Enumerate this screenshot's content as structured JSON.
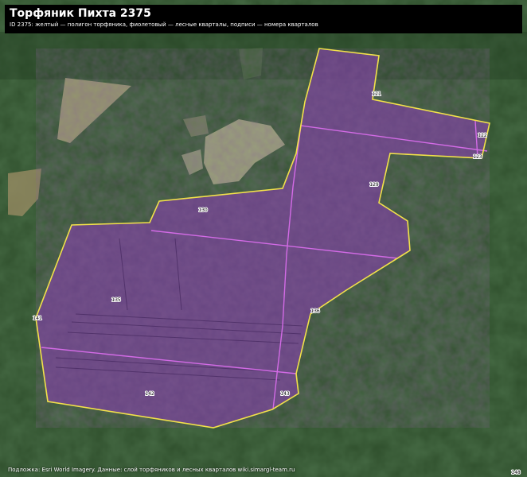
{
  "map": {
    "title": "Торфяник Пихта 2375",
    "subtitle": "ID 2375: желтый — полигон торфяника, фиолетовый — лесные кварталы, подписи — номера кварталов",
    "credit": "Подложка: Esri World Imagery. Данные: слой торфяников и лесных кварталов wiki.simargl-team.ru",
    "scale_label": "1:16",
    "colors": {
      "peat_outline": "#f2e14a",
      "quarter_fill": "#7a3fa0",
      "quarter_line": "#d36be6",
      "forest": "#2f4f2c",
      "title_bg": "#000000"
    },
    "quarters": [
      {
        "label": "121"
      },
      {
        "label": "122"
      },
      {
        "label": "123"
      },
      {
        "label": "129"
      },
      {
        "label": "130"
      },
      {
        "label": "135"
      },
      {
        "label": "136"
      },
      {
        "label": "141"
      },
      {
        "label": "142"
      },
      {
        "label": "143"
      },
      {
        "label": "148"
      }
    ]
  }
}
